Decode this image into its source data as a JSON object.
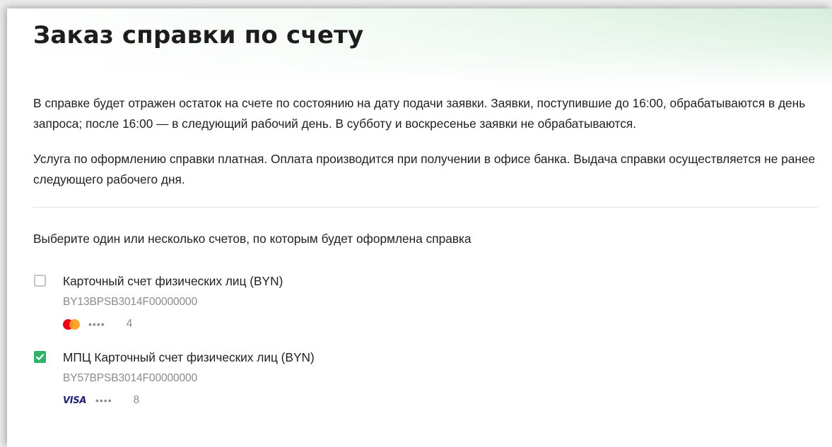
{
  "page": {
    "title": "Заказ справки по счету",
    "info_paragraph_1": "В справке будет отражен остаток на счете по состоянию на дату подачи заявки. Заявки, поступившие до 16:00, обрабатываются в день запроса; после 16:00 — в следующий рабочий день. В субботу и воскресенье заявки не обрабатываются.",
    "info_paragraph_2": "Услуга по оформлению справки платная. Оплата производится при получении в офисе банка. Выдача справки осуществляется не ранее следующего рабочего дня.",
    "select_prompt": "Выберите один или несколько счетов, по которым будет оформлена справка"
  },
  "accounts": [
    {
      "name": "Карточный счет физических лиц (BYN)",
      "number": "BY13BPSB3014F00000000",
      "checked": false,
      "card_brand_icon": "mastercard-icon",
      "masked_dots": "••••",
      "last_digits": "4"
    },
    {
      "name": "МПЦ Карточный счет физических лиц (BYN)",
      "number": "BY57BPSB3014F00000000",
      "checked": true,
      "card_brand_icon": "visa-icon",
      "card_brand_label": "VISA",
      "masked_dots": "••••",
      "last_digits": "8"
    }
  ],
  "colors": {
    "accent_green": "#2fb36b",
    "header_gradient_green": "#d6eedc",
    "mastercard_red": "#eb001b",
    "mastercard_orange": "#f79e1b",
    "visa_blue": "#1a1f71"
  }
}
